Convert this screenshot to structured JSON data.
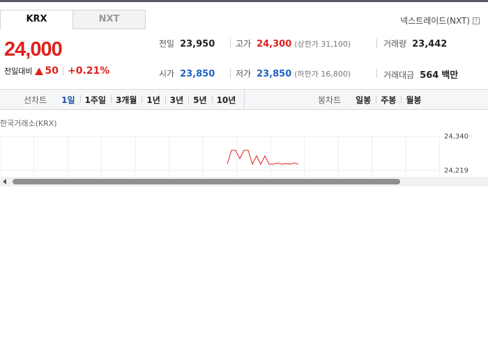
{
  "market_tabs": [
    {
      "label": "KRX",
      "active": true
    },
    {
      "label": "NXT",
      "active": false
    }
  ],
  "nxt_link": {
    "label": "넥스트레이드(NXT)",
    "help_icon": "?"
  },
  "quote": {
    "price": "24,000",
    "change_label": "전일대비",
    "change_direction_icon": "up-triangle-icon",
    "change_value": "50",
    "change_rate": "+0.21%"
  },
  "stats": {
    "prev_close": {
      "label": "전일",
      "value": "23,950"
    },
    "high": {
      "label": "고가",
      "value": "24,300",
      "sub": "(상한가 31,100)"
    },
    "volume": {
      "label": "거래량",
      "value": "23,442"
    },
    "open": {
      "label": "시가",
      "value": "23,850"
    },
    "low": {
      "label": "저가",
      "value": "23,850",
      "sub": "(하한가 16,800)"
    },
    "amount": {
      "label": "거래대금",
      "value": "564",
      "unit": "백만"
    }
  },
  "chart_toolbar": {
    "line_title": "선차트",
    "line_options": [
      "1일",
      "1주일",
      "3개월",
      "1년",
      "3년",
      "5년",
      "10년"
    ],
    "line_active": "1일",
    "candle_title": "봉차트",
    "candle_options": [
      "일봉",
      "주봉",
      "월봉"
    ]
  },
  "exchange_label": "한국거래소(KRX)",
  "chart_data": {
    "type": "line",
    "y_ticks": [
      "24,340",
      "24,219"
    ],
    "ylim": [
      24100,
      24400
    ],
    "grid": true,
    "series": [
      {
        "color": "#e0201b",
        "values": [
          24200,
          24300,
          24300,
          24240,
          24300,
          24300,
          24200,
          24260,
          24200,
          24260,
          24200,
          24200,
          24210,
          24200,
          24205,
          24200,
          24210,
          24200
        ]
      }
    ]
  },
  "colors": {
    "up": "#e0201b",
    "down": "#1d63c8",
    "active_tab": "#1d4ea8"
  }
}
